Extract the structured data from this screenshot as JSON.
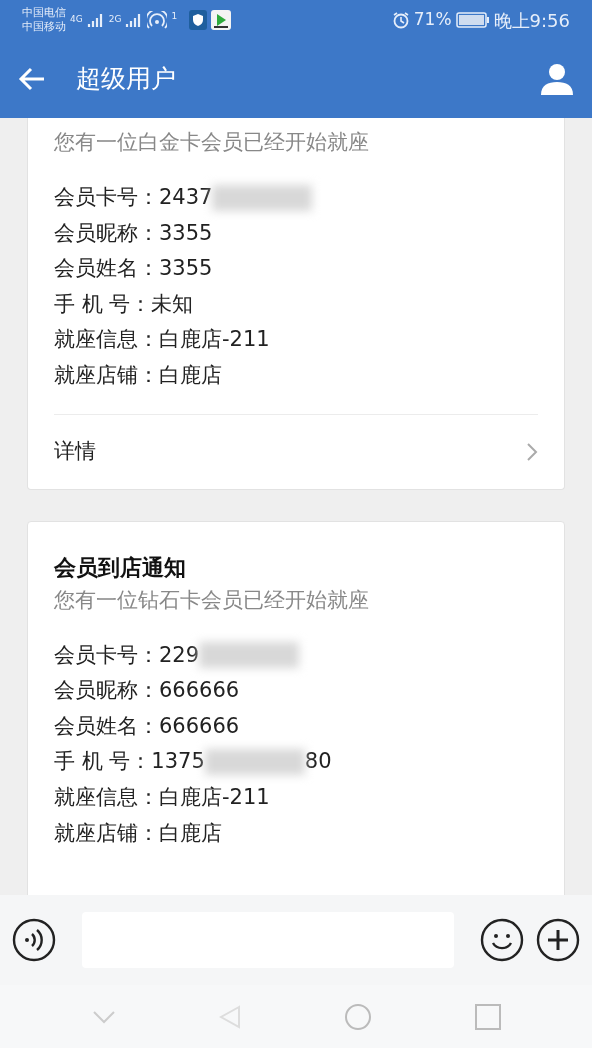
{
  "status_bar": {
    "carriers": [
      "中国电信",
      "中国移动"
    ],
    "signal_labels": [
      "4G",
      "2G"
    ],
    "hotspot_count": "1",
    "battery": "71%",
    "time": "晚上9:56"
  },
  "app_bar": {
    "title": "超级用户"
  },
  "messages": [
    {
      "subtitle": "您有一位白金卡会员已经开始就座",
      "fields": [
        {
          "label": "会员卡号：",
          "value": "2437",
          "blurred": true
        },
        {
          "label": "会员昵称：",
          "value": "3355",
          "blurred": false
        },
        {
          "label": "会员姓名：",
          "value": "3355",
          "blurred": false
        },
        {
          "label": "手 机 号：",
          "value": "未知",
          "blurred": false
        },
        {
          "label": "就座信息：",
          "value": "白鹿店-211",
          "blurred": false
        },
        {
          "label": "就座店铺：",
          "value": "白鹿店",
          "blurred": false
        }
      ],
      "link": "详情"
    },
    {
      "title": "会员到店通知",
      "subtitle": "您有一位钻石卡会员已经开始就座",
      "fields": [
        {
          "label": "会员卡号：",
          "value": "229",
          "blurred": true
        },
        {
          "label": "会员昵称：",
          "value": "666666",
          "blurred": false
        },
        {
          "label": "会员姓名：",
          "value": "666666",
          "blurred": false
        },
        {
          "label": "手 机 号：",
          "value": "1375",
          "blurred": true,
          "value_after_blur": "80"
        },
        {
          "label": "就座信息：",
          "value": "白鹿店-211",
          "blurred": false
        },
        {
          "label": "就座店铺：",
          "value": "白鹿店",
          "blurred": false
        }
      ]
    }
  ]
}
